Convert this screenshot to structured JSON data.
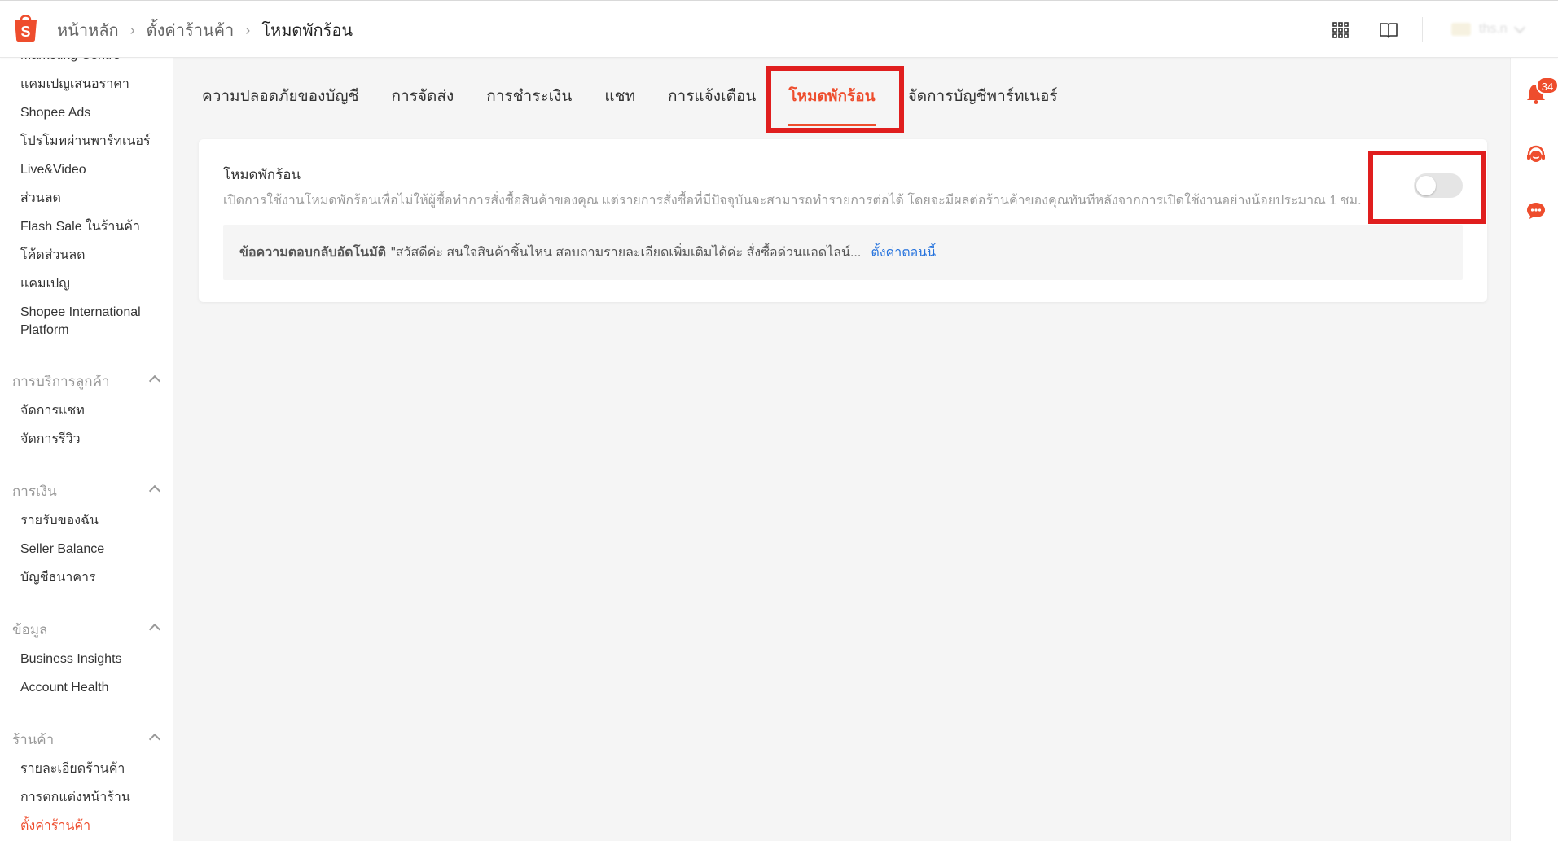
{
  "header": {
    "breadcrumb": [
      "หน้าหลัก",
      "ตั้งค่าร้านค้า",
      "โหมดพักร้อน"
    ],
    "user_name": "ths.n"
  },
  "sidebar": {
    "marketing_items": [
      "Marketing Centre",
      "แคมเปญเสนอราคา",
      "Shopee Ads",
      "โปรโมทผ่านพาร์ทเนอร์",
      "Live&Video",
      "ส่วนลด",
      "Flash Sale ในร้านค้า",
      "โค้ดส่วนลด",
      "แคมเปญ",
      "Shopee International Platform"
    ],
    "sections": [
      {
        "title": "การบริการลูกค้า",
        "items": [
          "จัดการแชท",
          "จัดการรีวิว"
        ]
      },
      {
        "title": "การเงิน",
        "items": [
          "รายรับของฉัน",
          "Seller Balance",
          "บัญชีธนาคาร"
        ]
      },
      {
        "title": "ข้อมูล",
        "items": [
          "Business Insights",
          "Account Health"
        ]
      },
      {
        "title": "ร้านค้า",
        "items": [
          "รายละเอียดร้านค้า",
          "การตกแต่งหน้าร้าน",
          "ตั้งค่าร้านค้า"
        ]
      }
    ],
    "active_item": "ตั้งค่าร้านค้า"
  },
  "tabs": [
    {
      "label": "ความปลอดภัยของบัญชี",
      "active": false
    },
    {
      "label": "การจัดส่ง",
      "active": false
    },
    {
      "label": "การชำระเงิน",
      "active": false
    },
    {
      "label": "แชท",
      "active": false
    },
    {
      "label": "การแจ้งเตือน",
      "active": false
    },
    {
      "label": "โหมดพักร้อน",
      "active": true
    },
    {
      "label": "จัดการบัญชีพาร์ทเนอร์",
      "active": false
    }
  ],
  "vacation": {
    "title": "โหมดพักร้อน",
    "description": "เปิดการใช้งานโหมดพักร้อนเพื่อไม่ให้ผู้ซื้อทำการสั่งซื้อสินค้าของคุณ แต่รายการสั่งซื้อที่มีปัจจุบันจะสามารถทำรายการต่อได้ โดยจะมีผลต่อร้านค้าของคุณทันทีหลังจากการเปิดใช้งานอย่างน้อยประมาณ 1 ชม.",
    "toggle_on": false,
    "auto_reply_label": "ข้อความตอบกลับอัตโนมัติ",
    "auto_reply_message": "\"สวัสดีค่ะ สนใจสินค้าชิ้นไหน สอบถามรายละเอียดเพิ่มเติมได้ค่ะ สั่งซื้อด่วนแอดไลน์...",
    "setup_link": "ตั้งค่าตอนนี้"
  },
  "right_rail": {
    "notification_count": "34"
  },
  "colors": {
    "brand": "#ee4d2d",
    "link": "#2673dd",
    "annotation": "#e01e1e"
  }
}
